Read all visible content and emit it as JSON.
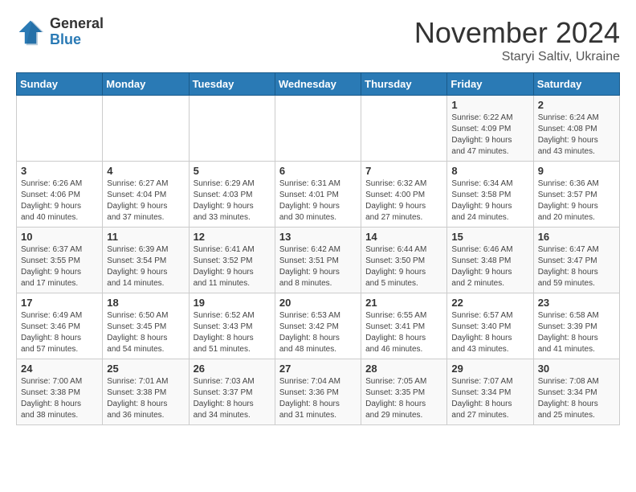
{
  "logo": {
    "general": "General",
    "blue": "Blue"
  },
  "title": "November 2024",
  "location": "Staryi Saltiv, Ukraine",
  "days_of_week": [
    "Sunday",
    "Monday",
    "Tuesday",
    "Wednesday",
    "Thursday",
    "Friday",
    "Saturday"
  ],
  "weeks": [
    [
      {
        "day": "",
        "info": ""
      },
      {
        "day": "",
        "info": ""
      },
      {
        "day": "",
        "info": ""
      },
      {
        "day": "",
        "info": ""
      },
      {
        "day": "",
        "info": ""
      },
      {
        "day": "1",
        "info": "Sunrise: 6:22 AM\nSunset: 4:09 PM\nDaylight: 9 hours\nand 47 minutes."
      },
      {
        "day": "2",
        "info": "Sunrise: 6:24 AM\nSunset: 4:08 PM\nDaylight: 9 hours\nand 43 minutes."
      }
    ],
    [
      {
        "day": "3",
        "info": "Sunrise: 6:26 AM\nSunset: 4:06 PM\nDaylight: 9 hours\nand 40 minutes."
      },
      {
        "day": "4",
        "info": "Sunrise: 6:27 AM\nSunset: 4:04 PM\nDaylight: 9 hours\nand 37 minutes."
      },
      {
        "day": "5",
        "info": "Sunrise: 6:29 AM\nSunset: 4:03 PM\nDaylight: 9 hours\nand 33 minutes."
      },
      {
        "day": "6",
        "info": "Sunrise: 6:31 AM\nSunset: 4:01 PM\nDaylight: 9 hours\nand 30 minutes."
      },
      {
        "day": "7",
        "info": "Sunrise: 6:32 AM\nSunset: 4:00 PM\nDaylight: 9 hours\nand 27 minutes."
      },
      {
        "day": "8",
        "info": "Sunrise: 6:34 AM\nSunset: 3:58 PM\nDaylight: 9 hours\nand 24 minutes."
      },
      {
        "day": "9",
        "info": "Sunrise: 6:36 AM\nSunset: 3:57 PM\nDaylight: 9 hours\nand 20 minutes."
      }
    ],
    [
      {
        "day": "10",
        "info": "Sunrise: 6:37 AM\nSunset: 3:55 PM\nDaylight: 9 hours\nand 17 minutes."
      },
      {
        "day": "11",
        "info": "Sunrise: 6:39 AM\nSunset: 3:54 PM\nDaylight: 9 hours\nand 14 minutes."
      },
      {
        "day": "12",
        "info": "Sunrise: 6:41 AM\nSunset: 3:52 PM\nDaylight: 9 hours\nand 11 minutes."
      },
      {
        "day": "13",
        "info": "Sunrise: 6:42 AM\nSunset: 3:51 PM\nDaylight: 9 hours\nand 8 minutes."
      },
      {
        "day": "14",
        "info": "Sunrise: 6:44 AM\nSunset: 3:50 PM\nDaylight: 9 hours\nand 5 minutes."
      },
      {
        "day": "15",
        "info": "Sunrise: 6:46 AM\nSunset: 3:48 PM\nDaylight: 9 hours\nand 2 minutes."
      },
      {
        "day": "16",
        "info": "Sunrise: 6:47 AM\nSunset: 3:47 PM\nDaylight: 8 hours\nand 59 minutes."
      }
    ],
    [
      {
        "day": "17",
        "info": "Sunrise: 6:49 AM\nSunset: 3:46 PM\nDaylight: 8 hours\nand 57 minutes."
      },
      {
        "day": "18",
        "info": "Sunrise: 6:50 AM\nSunset: 3:45 PM\nDaylight: 8 hours\nand 54 minutes."
      },
      {
        "day": "19",
        "info": "Sunrise: 6:52 AM\nSunset: 3:43 PM\nDaylight: 8 hours\nand 51 minutes."
      },
      {
        "day": "20",
        "info": "Sunrise: 6:53 AM\nSunset: 3:42 PM\nDaylight: 8 hours\nand 48 minutes."
      },
      {
        "day": "21",
        "info": "Sunrise: 6:55 AM\nSunset: 3:41 PM\nDaylight: 8 hours\nand 46 minutes."
      },
      {
        "day": "22",
        "info": "Sunrise: 6:57 AM\nSunset: 3:40 PM\nDaylight: 8 hours\nand 43 minutes."
      },
      {
        "day": "23",
        "info": "Sunrise: 6:58 AM\nSunset: 3:39 PM\nDaylight: 8 hours\nand 41 minutes."
      }
    ],
    [
      {
        "day": "24",
        "info": "Sunrise: 7:00 AM\nSunset: 3:38 PM\nDaylight: 8 hours\nand 38 minutes."
      },
      {
        "day": "25",
        "info": "Sunrise: 7:01 AM\nSunset: 3:38 PM\nDaylight: 8 hours\nand 36 minutes."
      },
      {
        "day": "26",
        "info": "Sunrise: 7:03 AM\nSunset: 3:37 PM\nDaylight: 8 hours\nand 34 minutes."
      },
      {
        "day": "27",
        "info": "Sunrise: 7:04 AM\nSunset: 3:36 PM\nDaylight: 8 hours\nand 31 minutes."
      },
      {
        "day": "28",
        "info": "Sunrise: 7:05 AM\nSunset: 3:35 PM\nDaylight: 8 hours\nand 29 minutes."
      },
      {
        "day": "29",
        "info": "Sunrise: 7:07 AM\nSunset: 3:34 PM\nDaylight: 8 hours\nand 27 minutes."
      },
      {
        "day": "30",
        "info": "Sunrise: 7:08 AM\nSunset: 3:34 PM\nDaylight: 8 hours\nand 25 minutes."
      }
    ]
  ]
}
